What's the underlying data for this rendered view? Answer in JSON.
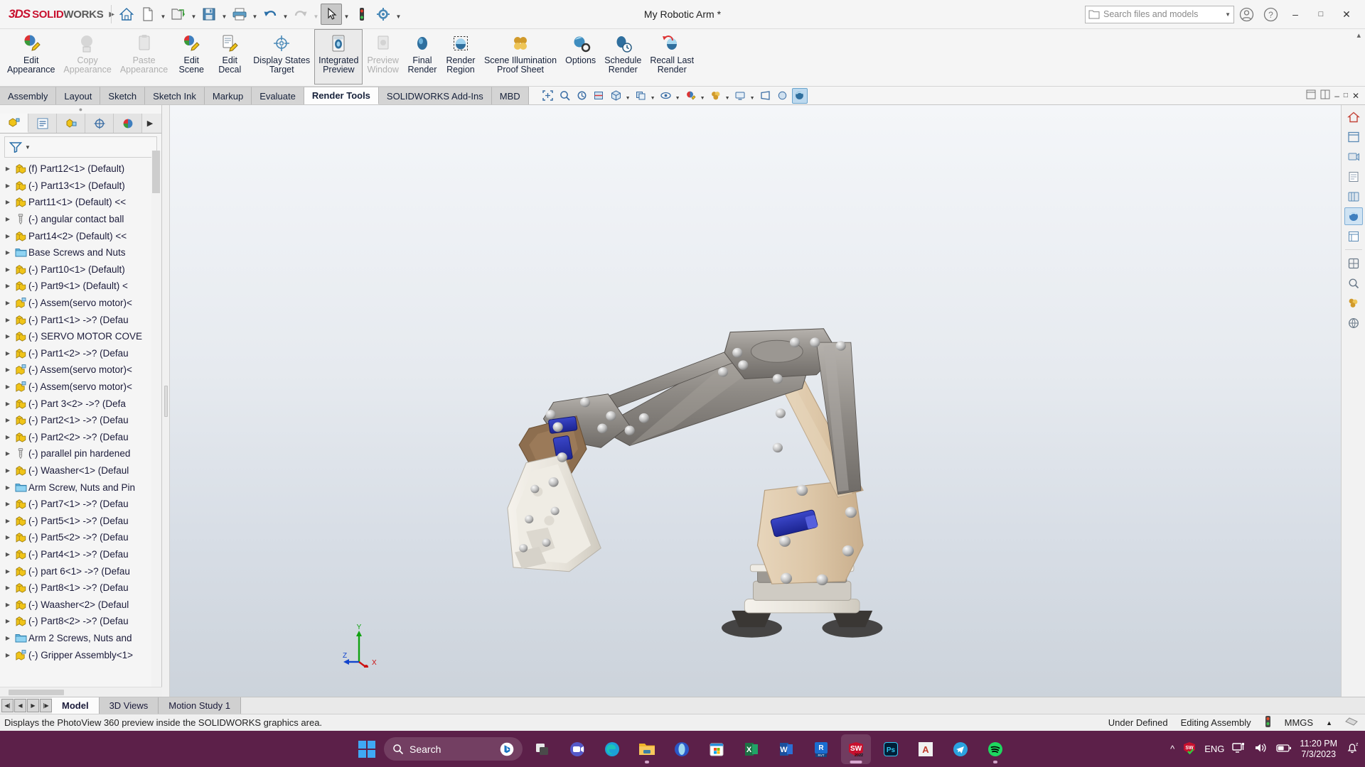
{
  "titlebar": {
    "brand_ds": "3DS",
    "brand_solid": "SOLID",
    "brand_works": "WORKS",
    "document_title": "My Robotic Arm *",
    "quick_access": [
      {
        "name": "home-icon",
        "tooltip": "Home"
      },
      {
        "name": "new-document-icon",
        "tooltip": "New"
      },
      {
        "name": "open-folder-icon",
        "tooltip": "Open"
      },
      {
        "name": "save-icon",
        "tooltip": "Save"
      },
      {
        "name": "print-icon",
        "tooltip": "Print"
      },
      {
        "name": "undo-icon",
        "tooltip": "Undo"
      },
      {
        "name": "redo-icon",
        "tooltip": "Redo"
      },
      {
        "name": "select-cursor-icon",
        "tooltip": "Select"
      },
      {
        "name": "rebuild-icon",
        "tooltip": "Rebuild"
      },
      {
        "name": "options-gear-icon",
        "tooltip": "Options"
      }
    ],
    "search": {
      "placeholder": "Search files and models"
    },
    "window_buttons": [
      "minimize",
      "maximize",
      "close"
    ]
  },
  "ribbon": {
    "items": [
      {
        "label": "Edit\nAppearance",
        "icon": "edit-appearance-icon",
        "state": "enabled"
      },
      {
        "label": "Copy\nAppearance",
        "icon": "copy-appearance-icon",
        "state": "disabled"
      },
      {
        "label": "Paste\nAppearance",
        "icon": "paste-appearance-icon",
        "state": "disabled"
      },
      {
        "label": "Edit\nScene",
        "icon": "edit-scene-icon",
        "state": "enabled"
      },
      {
        "label": "Edit\nDecal",
        "icon": "edit-decal-icon",
        "state": "enabled"
      },
      {
        "label": "Display States\nTarget",
        "icon": "display-states-target-icon",
        "state": "enabled"
      },
      {
        "label": "Integrated\nPreview",
        "icon": "integrated-preview-icon",
        "state": "selected"
      },
      {
        "label": "Preview\nWindow",
        "icon": "preview-window-icon",
        "state": "disabled"
      },
      {
        "label": "Final\nRender",
        "icon": "final-render-icon",
        "state": "enabled"
      },
      {
        "label": "Render\nRegion",
        "icon": "render-region-icon",
        "state": "enabled"
      },
      {
        "label": "Scene Illumination\nProof Sheet",
        "icon": "scene-illumination-proof-sheet-icon",
        "state": "enabled"
      },
      {
        "label": "Options",
        "icon": "render-options-icon",
        "state": "enabled"
      },
      {
        "label": "Schedule\nRender",
        "icon": "schedule-render-icon",
        "state": "enabled"
      },
      {
        "label": "Recall Last\nRender",
        "icon": "recall-last-render-icon",
        "state": "enabled"
      }
    ]
  },
  "command_tabs": {
    "tabs": [
      {
        "label": "Assembly",
        "active": false
      },
      {
        "label": "Layout",
        "active": false
      },
      {
        "label": "Sketch",
        "active": false
      },
      {
        "label": "Sketch Ink",
        "active": false
      },
      {
        "label": "Markup",
        "active": false
      },
      {
        "label": "Evaluate",
        "active": false
      },
      {
        "label": "Render Tools",
        "active": true
      },
      {
        "label": "SOLIDWORKS Add-Ins",
        "active": false
      },
      {
        "label": "MBD",
        "active": false
      }
    ],
    "view_tools": [
      {
        "name": "zoom-to-fit-icon"
      },
      {
        "name": "zoom-to-area-icon"
      },
      {
        "name": "previous-view-icon"
      },
      {
        "name": "section-view-icon"
      },
      {
        "name": "view-orientation-icon"
      },
      {
        "name": "display-style-icon"
      },
      {
        "name": "hide-show-items-icon"
      },
      {
        "name": "edit-appearance-small-icon"
      },
      {
        "name": "apply-scene-icon"
      },
      {
        "name": "view-settings-icon"
      },
      {
        "name": "perspective-icon"
      },
      {
        "name": "realview-graphics-icon"
      }
    ]
  },
  "feature_manager": {
    "tabs": [
      {
        "name": "feature-tree-tab",
        "active": true
      },
      {
        "name": "property-manager-tab",
        "active": false
      },
      {
        "name": "configuration-manager-tab",
        "active": false
      },
      {
        "name": "dimxpert-manager-tab",
        "active": false
      },
      {
        "name": "display-manager-tab",
        "active": false
      },
      {
        "name": "more-tabs-chevron",
        "active": false
      }
    ],
    "filter": {
      "placeholder": "",
      "icon": "filter-icon"
    },
    "tree_items": [
      {
        "label": "(f) Part12<1> (Default)",
        "icon": "part-icon"
      },
      {
        "label": "(-) Part13<1> (Default)",
        "icon": "part-icon"
      },
      {
        "label": "Part11<1> (Default) <<",
        "icon": "part-icon"
      },
      {
        "label": "(-) angular contact ball",
        "icon": "hardware-icon"
      },
      {
        "label": "Part14<2> (Default) <<",
        "icon": "part-icon"
      },
      {
        "label": "Base Screws and Nuts",
        "icon": "folder-icon"
      },
      {
        "label": "(-) Part10<1> (Default)",
        "icon": "part-icon"
      },
      {
        "label": "(-) Part9<1> (Default) <",
        "icon": "part-icon"
      },
      {
        "label": "(-) Assem(servo motor)<",
        "icon": "assembly-icon"
      },
      {
        "label": "(-) Part1<1> ->? (Defau",
        "icon": "part-icon"
      },
      {
        "label": "(-) SERVO MOTOR COVE",
        "icon": "part-icon"
      },
      {
        "label": "(-) Part1<2> ->? (Defau",
        "icon": "part-icon"
      },
      {
        "label": "(-) Assem(servo motor)<",
        "icon": "assembly-icon"
      },
      {
        "label": "(-) Assem(servo motor)<",
        "icon": "assembly-icon"
      },
      {
        "label": "(-) Part 3<2> ->? (Defa",
        "icon": "part-icon"
      },
      {
        "label": "(-) Part2<1> ->? (Defau",
        "icon": "part-icon"
      },
      {
        "label": "(-) Part2<2> ->? (Defau",
        "icon": "part-icon"
      },
      {
        "label": "(-) parallel pin hardened",
        "icon": "hardware-icon"
      },
      {
        "label": "(-) Waasher<1> (Defaul",
        "icon": "part-icon"
      },
      {
        "label": "Arm Screw, Nuts and Pin",
        "icon": "folder-icon"
      },
      {
        "label": "(-) Part7<1> ->? (Defau",
        "icon": "part-icon"
      },
      {
        "label": "(-) Part5<1> ->? (Defau",
        "icon": "part-icon"
      },
      {
        "label": "(-) Part5<2> ->? (Defau",
        "icon": "part-icon"
      },
      {
        "label": "(-) Part4<1> ->? (Defau",
        "icon": "part-icon"
      },
      {
        "label": "(-) part 6<1> ->? (Defau",
        "icon": "part-icon"
      },
      {
        "label": "(-) Part8<1> ->? (Defau",
        "icon": "part-icon"
      },
      {
        "label": "(-) Waasher<2> (Defaul",
        "icon": "part-icon"
      },
      {
        "label": "(-) Part8<2> ->? (Defau",
        "icon": "part-icon"
      },
      {
        "label": "Arm 2 Screws, Nuts and",
        "icon": "folder-icon"
      },
      {
        "label": "(-) Gripper Assembly<1>",
        "icon": "assembly-icon"
      }
    ]
  },
  "graphics": {
    "triad": {
      "x_label": "Z",
      "y_label": "Y",
      "origin_label": "X"
    },
    "model_name": "Robotic arm assembly render preview"
  },
  "right_toolbar": {
    "icons": [
      {
        "name": "view-home-icon"
      },
      {
        "name": "display-pane-icon"
      },
      {
        "name": "appearances-icon"
      },
      {
        "name": "scenes-lights-cameras-icon"
      },
      {
        "name": "decals-icon"
      },
      {
        "name": "design-library-icon"
      },
      {
        "name": "file-explorer-icon"
      },
      {
        "name": "view-palette-icon"
      },
      {
        "name": "appearances-panel-icon"
      },
      {
        "name": "custom-properties-icon"
      },
      {
        "name": "solidworks-forum-icon"
      }
    ]
  },
  "bottom_tabs": {
    "nav_buttons": [
      "first",
      "previous",
      "next",
      "last"
    ],
    "tabs": [
      {
        "label": "Model",
        "active": true
      },
      {
        "label": "3D Views",
        "active": false
      },
      {
        "label": "Motion Study 1",
        "active": false
      }
    ]
  },
  "status_bar": {
    "message": "Displays the PhotoView 360 preview inside the SOLIDWORKS graphics area.",
    "state": "Under Defined",
    "edit_mode": "Editing Assembly",
    "units": "MMGS",
    "indicator_icon": "traffic-light-icon",
    "overlay_icon": "overlay-icon"
  },
  "taskbar": {
    "search_placeholder": "Search",
    "apps": [
      {
        "name": "start-button-icon",
        "label": "Start"
      },
      {
        "name": "bing-chat-icon",
        "label": "Bing Chat"
      },
      {
        "name": "task-view-icon",
        "label": "Task View"
      },
      {
        "name": "teams-icon",
        "label": "Microsoft Teams"
      },
      {
        "name": "edge-browser-icon",
        "label": "Microsoft Edge"
      },
      {
        "name": "file-explorer-icon",
        "label": "File Explorer"
      },
      {
        "name": "opera-gx-icon",
        "label": "Opera"
      },
      {
        "name": "microsoft-store-icon",
        "label": "Microsoft Store"
      },
      {
        "name": "excel-icon",
        "label": "Excel"
      },
      {
        "name": "word-icon",
        "label": "Word"
      },
      {
        "name": "revit-icon",
        "label": "Revit"
      },
      {
        "name": "solidworks-2022-icon",
        "label": "SOLIDWORKS 2022"
      },
      {
        "name": "photoshop-icon",
        "label": "Photoshop"
      },
      {
        "name": "autocad-icon",
        "label": "AutoCAD"
      },
      {
        "name": "telegram-icon",
        "label": "Telegram"
      },
      {
        "name": "spotify-icon",
        "label": "Spotify"
      }
    ],
    "tray": {
      "chevron": "show-hidden-icons-icon",
      "sw_tray": "solidworks-tray-icon",
      "language": "ENG",
      "network": "network-icon",
      "volume": "volume-icon",
      "battery": "battery-icon",
      "time": "11:20 PM",
      "date": "7/3/2023",
      "notifications": "notifications-bell-icon"
    }
  }
}
